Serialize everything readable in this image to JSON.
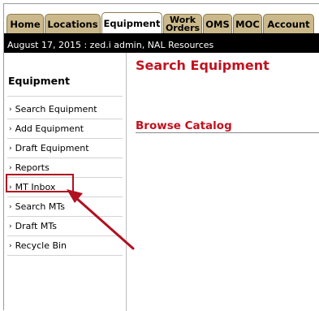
{
  "tabs": [
    {
      "label": "Home",
      "active": false
    },
    {
      "label": "Locations",
      "active": false
    },
    {
      "label": "Equipment",
      "active": true
    },
    {
      "label": "Work Orders",
      "line1": "Work",
      "line2": "Orders",
      "active": false
    },
    {
      "label": "OMS",
      "active": false
    },
    {
      "label": "MOC",
      "active": false
    },
    {
      "label": "Account",
      "active": false
    }
  ],
  "infobar": {
    "text": "August 17, 2015 : zed.i admin, NAL Resources"
  },
  "sidebar": {
    "title": "Equipment",
    "items": [
      {
        "label": "Search Equipment"
      },
      {
        "label": "Add Equipment"
      },
      {
        "label": "Draft Equipment"
      },
      {
        "label": "Reports"
      },
      {
        "label": "MT Inbox",
        "highlighted": true
      },
      {
        "label": "Search MTs"
      },
      {
        "label": "Draft MTs"
      },
      {
        "label": "Recycle Bin"
      }
    ]
  },
  "main": {
    "title": "Search Equipment",
    "section_title": "Browse Catalog"
  },
  "colors": {
    "tab_bg": "#cbb98c",
    "heading_red": "#c1121f",
    "annotation_red": "#b01020",
    "bar_black": "#000000"
  },
  "icons": {
    "nav_bullet": "chevron-right-icon"
  }
}
